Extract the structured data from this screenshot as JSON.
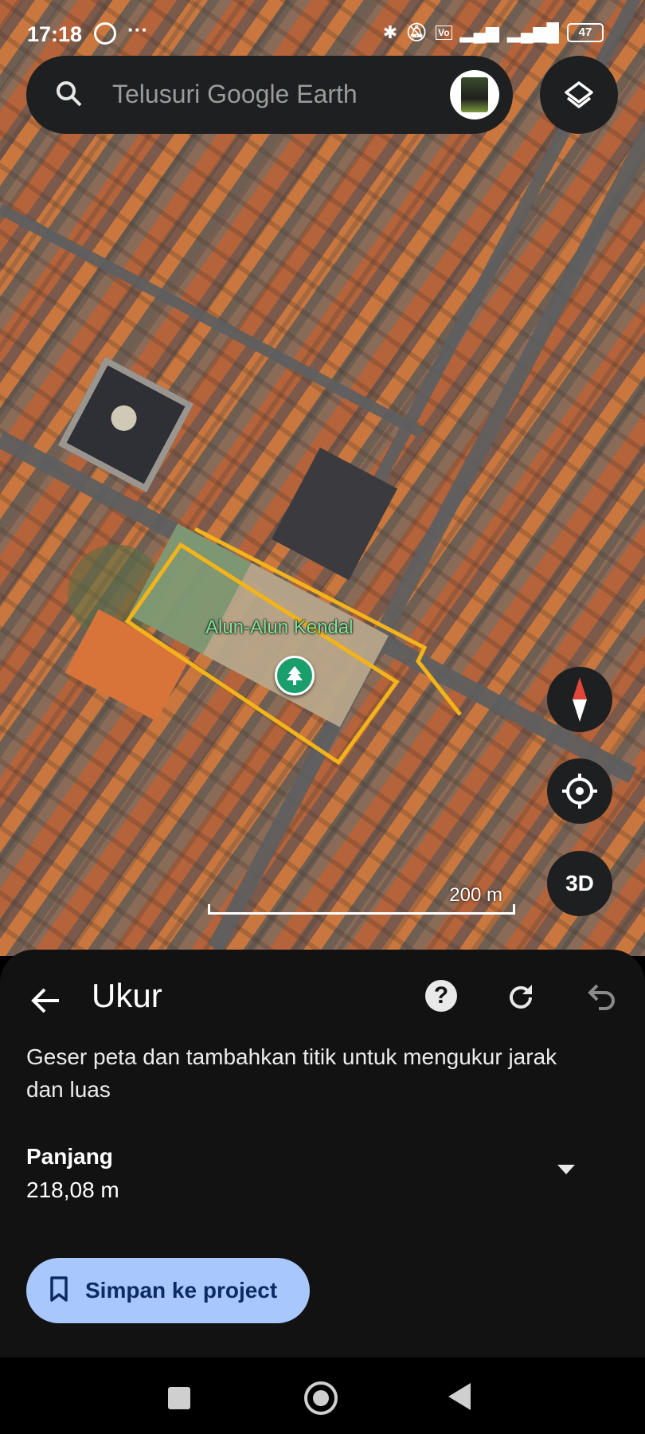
{
  "status_bar": {
    "time": "17:18",
    "notification_icons": [
      "whatsapp-icon",
      "more-dots-icon"
    ],
    "system_icons": [
      "bluetooth-icon",
      "alarm-off-icon",
      "volte-icon",
      "signal-icon",
      "4g-signal-icon"
    ],
    "battery": "47"
  },
  "search": {
    "placeholder": "Telusuri Google Earth"
  },
  "map": {
    "place_label": "Alun-Alun Kendal",
    "place_icon": "park-tree-icon",
    "measure_line_color": "#f2b31b",
    "scale_label": "200 m",
    "threed_label": "3D"
  },
  "sheet": {
    "title": "Ukur",
    "help_label": "?",
    "instruction": "Geser peta dan tambahkan titik untuk mengukur jarak dan luas",
    "measure_label": "Panjang",
    "measure_value": "218,08 m",
    "save_label": "Simpan ke project"
  },
  "colors": {
    "sheet_bg": "#121212",
    "button_bg": "#a8c7fa",
    "place_label": "#7fe39a",
    "pin": "#1a9e6b"
  }
}
